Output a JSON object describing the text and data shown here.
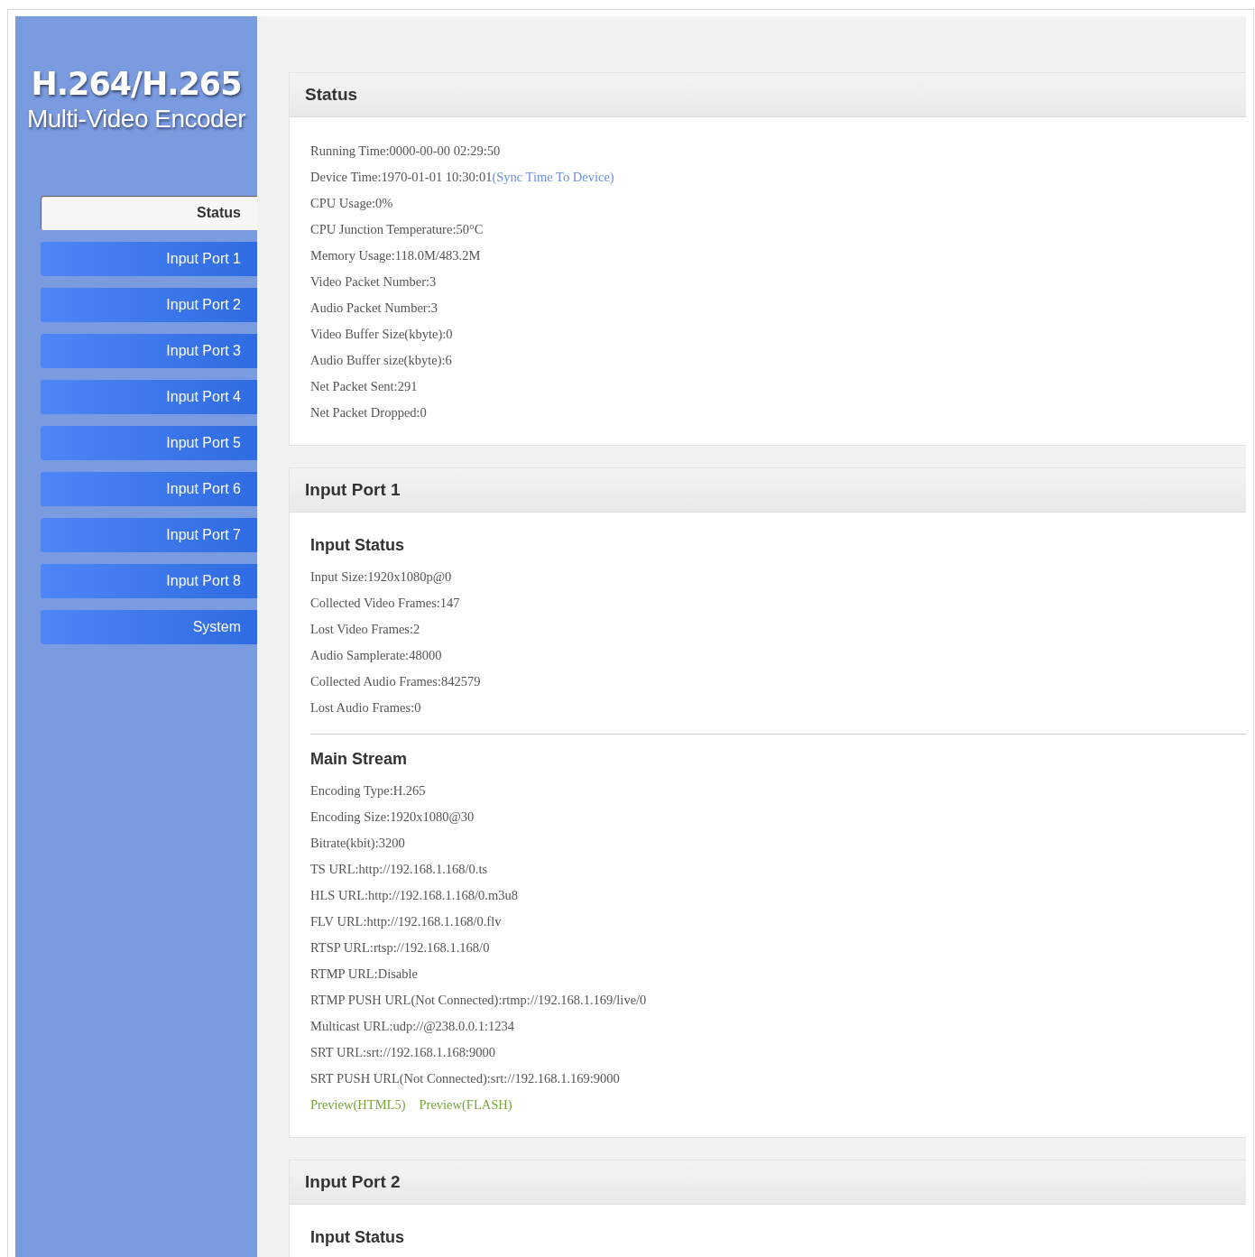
{
  "sidebar": {
    "logo": {
      "title": "H.264/H.265",
      "subtitle": "Multi-Video Encoder"
    },
    "items": [
      {
        "label": "Status",
        "selected": true
      },
      {
        "label": "Input Port 1",
        "selected": false
      },
      {
        "label": "Input Port 2",
        "selected": false
      },
      {
        "label": "Input Port 3",
        "selected": false
      },
      {
        "label": "Input Port 4",
        "selected": false
      },
      {
        "label": "Input Port 5",
        "selected": false
      },
      {
        "label": "Input Port 6",
        "selected": false
      },
      {
        "label": "Input Port 7",
        "selected": false
      },
      {
        "label": "Input Port 8",
        "selected": false
      },
      {
        "label": "System",
        "selected": false
      }
    ]
  },
  "sections": [
    {
      "title": "Status",
      "groups": [
        {
          "lines": [
            {
              "text": "Running Time:0000-00-00 02:29:50"
            },
            {
              "text": "Device Time:1970-01-01 10:30:01",
              "link": "(Sync Time To Device)"
            },
            {
              "text": "CPU Usage:0%"
            },
            {
              "text": "CPU Junction Temperature:50°C"
            },
            {
              "text": "Memory Usage:118.0M/483.2M"
            },
            {
              "text": "Video Packet Number:3"
            },
            {
              "text": "Audio Packet Number:3"
            },
            {
              "text": "Video Buffer Size(kbyte):0"
            },
            {
              "text": "Audio Buffer size(kbyte):6"
            },
            {
              "text": "Net Packet Sent:291"
            },
            {
              "text": "Net Packet Dropped:0"
            }
          ]
        }
      ]
    },
    {
      "title": "Input Port 1",
      "groups": [
        {
          "heading": "Input Status",
          "lines": [
            {
              "text": "Input Size:1920x1080p@0"
            },
            {
              "text": "Collected Video Frames:147"
            },
            {
              "text": "Lost Video Frames:2"
            },
            {
              "text": "Audio Samplerate:48000"
            },
            {
              "text": "Collected Audio Frames:842579"
            },
            {
              "text": "Lost Audio Frames:0"
            }
          ]
        },
        {
          "heading": "Main Stream",
          "lines": [
            {
              "text": "Encoding Type:H.265"
            },
            {
              "text": "Encoding Size:1920x1080@30"
            },
            {
              "text": "Bitrate(kbit):3200"
            },
            {
              "text": "TS URL:http://192.168.1.168/0.ts"
            },
            {
              "text": "HLS URL:http://192.168.1.168/0.m3u8"
            },
            {
              "text": "FLV URL:http://192.168.1.168/0.flv"
            },
            {
              "text": "RTSP URL:rtsp://192.168.1.168/0"
            },
            {
              "text": "RTMP URL:Disable"
            },
            {
              "text": "RTMP PUSH URL(Not Connected):rtmp://192.168.1.169/live/0"
            },
            {
              "text": "Multicast URL:udp://@238.0.0.1:1234"
            },
            {
              "text": "SRT URL:srt://192.168.1.168:9000"
            },
            {
              "text": "SRT PUSH URL(Not Connected):srt://192.168.1.169:9000"
            }
          ],
          "preview_links": [
            "Preview(HTML5)",
            "Preview(FLASH)"
          ]
        }
      ]
    },
    {
      "title": "Input Port 2",
      "groups": [
        {
          "heading": "Input Status"
        }
      ]
    }
  ]
}
